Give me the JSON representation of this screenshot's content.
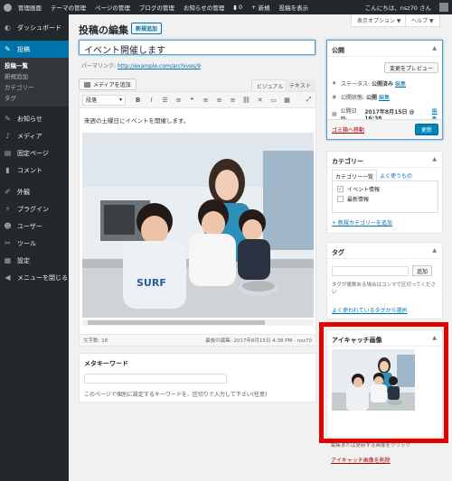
{
  "adminbar": {
    "items": [
      "管理画面",
      "テーマの管理",
      "ページの管理",
      "ブログの管理",
      "お知らせの管理"
    ],
    "comments_count": "0",
    "new_label": "新規",
    "view_post": "投稿を表示",
    "greeting": "こんにちは、nsz70 さん"
  },
  "sidebar": {
    "dashboard": "ダッシュボード",
    "posts": "投稿",
    "sub_items": [
      "投稿一覧",
      "新規追加",
      "カテゴリー",
      "タグ"
    ],
    "news": "お知らせ",
    "media": "メディア",
    "pages": "固定ページ",
    "comments": "コメント",
    "appearance": "外観",
    "plugins": "プラグイン",
    "users": "ユーザー",
    "tools": "ツール",
    "settings": "設定",
    "collapse": "メニューを閉じる"
  },
  "header": {
    "screen_options": "表示オプション ▼",
    "help": "ヘルプ ▼",
    "title": "投稿の編集",
    "add_new": "新規追加"
  },
  "post": {
    "title_value": "イベント開催します",
    "permalink_label": "パーマリンク:",
    "permalink_url": "http://example.com/archives/9",
    "add_media": "メディアを追加",
    "tab_visual": "ビジュアル",
    "tab_text": "テキスト",
    "format": "段落",
    "content": "来週の土曜日にイベントを開催します。",
    "word_count": "文字数: 18",
    "last_edited": "最後の編集: 2017年8月15日 4:38 PM - nsz70"
  },
  "meta_keyword": {
    "heading": "メタキーワード",
    "hint": "このページで個別に設定するキーワードを、区切りで入力して下さい(任意)"
  },
  "publish": {
    "heading": "公開",
    "preview": "変更をプレビュー",
    "status_label": "ステータス:",
    "status_value": "公開済み",
    "visibility_label": "公開状態:",
    "visibility_value": "公開",
    "date_label": "公開日時:",
    "date_value": "2017年8月15日 @ 16:38",
    "edit": "編集",
    "trash": "ゴミ箱へ移動",
    "update": "更新"
  },
  "categories": {
    "heading": "カテゴリー",
    "tab_all": "カテゴリー一覧",
    "tab_popular": "よく使うもの",
    "items": [
      {
        "label": "イベント情報",
        "checked": true
      },
      {
        "label": "最新情報",
        "checked": false
      }
    ],
    "add_new": "+ 新規カテゴリーを追加"
  },
  "tags": {
    "heading": "タグ",
    "add": "追加",
    "hint": "タグが複数ある場合はコンマで区切ってください",
    "choose": "よく使われているタグから選択"
  },
  "featured": {
    "heading": "アイキャッチ画像",
    "hint": "編集または更新する画像をクリック",
    "remove": "アイキャッチ画像を削除"
  },
  "colors": {
    "admin_bg": "#23282d",
    "accent": "#0073aa",
    "button_primary": "#0085ba",
    "highlight": "#e20000"
  }
}
